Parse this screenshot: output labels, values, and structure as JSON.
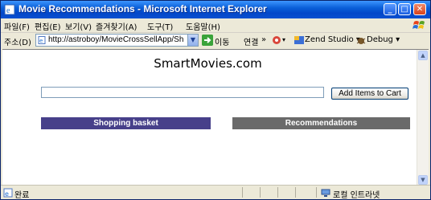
{
  "window": {
    "title": "Movie Recommendations - Microsoft Internet Explorer",
    "minimize_label": "_",
    "maximize_label": "□",
    "close_label": "✕"
  },
  "menu": {
    "items": [
      "파일(F)",
      "편집(E)",
      "보기(V)",
      "즐겨찾기(A)",
      "도구(T)",
      "도움말(H)"
    ]
  },
  "address_bar": {
    "label": "주소(D)",
    "url": "http://astroboy/MovieCrossSellApp/Shopping",
    "go_label": "이동",
    "links_label": "연결",
    "chevron": "»",
    "zend_label": "Zend Studio ▾",
    "debug_label": "Debug ▾",
    "tail_arrow": "▾"
  },
  "page": {
    "title": "SmartMovies.com",
    "item_input_value": "",
    "add_button_label": "Add Items to Cart",
    "basket_heading": "Shopping basket",
    "recommendations_heading": "Recommendations"
  },
  "status_bar": {
    "status_text": "완료",
    "zone_text": "로컬 인트라넷"
  },
  "colors": {
    "basket_header": "#47408a",
    "recommendations_header": "#6a6a6a",
    "titlebar": "#0a5fd8"
  },
  "icons": [
    "ie-page-icon",
    "windows-flag-icon",
    "page-icon",
    "go-arrow-icon",
    "tools-icon",
    "zend-icon",
    "debug-icon",
    "done-icon",
    "intranet-icon",
    "scroll-up-icon",
    "scroll-down-icon"
  ]
}
